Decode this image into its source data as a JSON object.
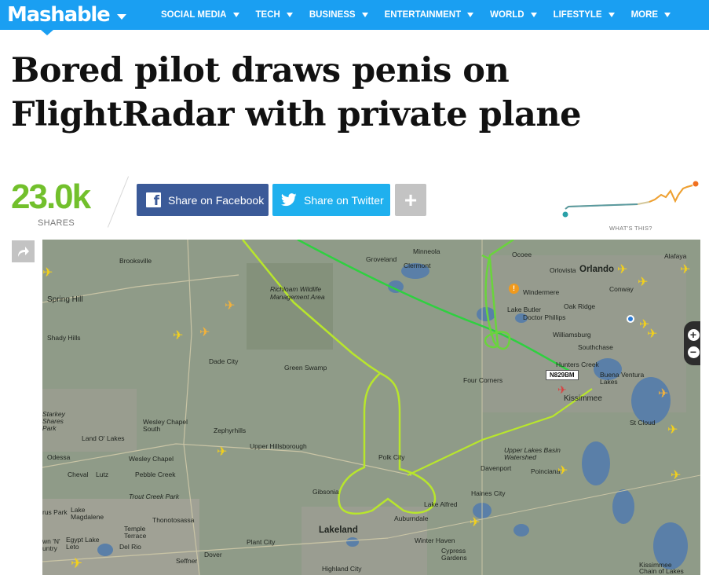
{
  "nav": {
    "logo": "Mashable",
    "items": [
      {
        "label": "SOCIAL MEDIA"
      },
      {
        "label": "TECH"
      },
      {
        "label": "BUSINESS"
      },
      {
        "label": "ENTERTAINMENT"
      },
      {
        "label": "WORLD"
      },
      {
        "label": "LIFESTYLE"
      },
      {
        "label": "MORE"
      }
    ]
  },
  "article": {
    "headline": "Bored pilot draws penis on FlightRadar with private plane"
  },
  "share": {
    "count": "23.0k",
    "count_label": "SHARES",
    "facebook_label": "Share on Facebook",
    "twitter_label": "Share on Twitter",
    "plus_label": "+",
    "whats_this": "WHAT'S THIS?"
  },
  "map": {
    "flight_id": "N829BM",
    "labels": {
      "brooksville": "Brooksville",
      "spring_hill": "Spring Hill",
      "shady_hills": "Shady Hills",
      "dade_city": "Dade City",
      "green_swamp": "Green Swamp",
      "richloam": "Richloam Wildlife Management Area",
      "groveland": "Groveland",
      "minneola": "Minneola",
      "clermont": "Clermont",
      "ocoee": "Ocoee",
      "orlovista": "Orlovista",
      "orlando": "Orlando",
      "alafaya": "Alafaya",
      "conway": "Conway",
      "windermere": "Windermere",
      "lake_butler": "Lake Butler",
      "doctor_phillips": "Doctor Phillips",
      "oak_ridge": "Oak Ridge",
      "williamsburg": "Williamsburg",
      "southchase": "Southchase",
      "hunters_creek": "Hunters Creek",
      "buena_ventura": "Buena Ventura Lakes",
      "kissimmee": "Kissimmee",
      "four_corners": "Four Corners",
      "st_cloud": "St Cloud",
      "wesley_chapel_south": "Wesley Chapel South",
      "zephyrhills": "Zephyrhills",
      "starkey": "Starkey Shares Park",
      "land_o_lakes": "Land O' Lakes",
      "upper_hillsborough": "Upper Hillsborough",
      "odessa": "Odessa",
      "wesley_chapel": "Wesley Chapel",
      "pebble_creek": "Pebble Creek",
      "cheval": "Cheval",
      "lutz": "Lutz",
      "trout_creek": "Trout Creek Park",
      "polk_city": "Polk City",
      "upper_lakes": "Upper Lakes Basin Watershed",
      "davenport": "Davenport",
      "poinciana": "Poinciana",
      "haines_city": "Haines City",
      "gibsonia": "Gibsonia",
      "lake_alfred": "Lake Alfred",
      "auburndale": "Auburndale",
      "lakeland": "Lakeland",
      "plant_city": "Plant City",
      "thonotosassa": "Thonotosassa",
      "temple_terrace": "Temple Terrace",
      "egypt": "Egypt Lake Leto",
      "del_rio": "Del Rio",
      "lake_magdalene": "Lake Magdalene",
      "dover": "Dover",
      "seffner": "Seffner",
      "winter_haven": "Winter Haven",
      "cypress_gardens": "Cypress Gardens",
      "highland": "Highland City",
      "kissimmee_chain": "Kissimmee Chain of Lakes",
      "town_n_country": "wn 'N' untry",
      "sus_park": "rus Park"
    }
  }
}
